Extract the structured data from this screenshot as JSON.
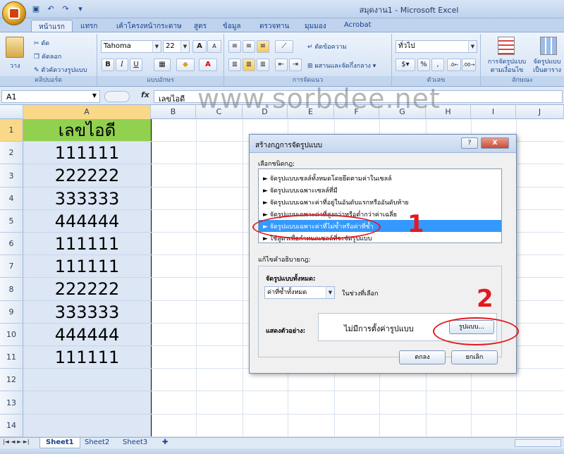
{
  "window": {
    "title": "สมุดงาน1 - Microsoft Excel"
  },
  "ribbon_tabs": [
    "หน้าแรก",
    "แทรก",
    "เค้าโครงหน้ากระดาษ",
    "สูตร",
    "ข้อมูล",
    "ตรวจทาน",
    "มุมมอง",
    "Acrobat"
  ],
  "clipboard": {
    "paste": "วาง",
    "cut": "ตัด",
    "copy": "คัดลอก",
    "format_painter": "ตัวคัดวางรูปแบบ",
    "label": "คลิปบอร์ด"
  },
  "font_group": {
    "font_name": "Tahoma",
    "font_size": "22",
    "bold": "B",
    "italic": "I",
    "underline": "U",
    "grow": "A",
    "shrink": "A",
    "label": "แบบอักษร"
  },
  "alignment_group": {
    "wrap_text": "ตัดข้อความ",
    "merge_center": "ผสานและจัดกึ่งกลาง",
    "label": "การจัดแนว"
  },
  "number_group": {
    "format": "ทั่วไป",
    "percent": "%",
    "comma": ",",
    "inc_decimal": "←.0 .00",
    "dec_decimal": ".00 →.0",
    "label": "ตัวเลข"
  },
  "styles_group": {
    "conditional": "การจัดรูปแบบ ตามเงื่อนไข",
    "as_table": "จัดรูปแบบ เป็นตาราง",
    "label": "ลักษณะ"
  },
  "formula_bar": {
    "name_box": "A1",
    "fx": "fx",
    "value": "เลขไอดี"
  },
  "watermark": "www.sorbdee.net",
  "columns": [
    "A",
    "B",
    "C",
    "D",
    "E",
    "F",
    "G",
    "H",
    "I",
    "J"
  ],
  "rows": [
    {
      "num": "1",
      "a": "เลขไอดี"
    },
    {
      "num": "2",
      "a": "111111"
    },
    {
      "num": "3",
      "a": "222222"
    },
    {
      "num": "4",
      "a": "333333"
    },
    {
      "num": "5",
      "a": "444444"
    },
    {
      "num": "6",
      "a": "111111"
    },
    {
      "num": "7",
      "a": "111111"
    },
    {
      "num": "8",
      "a": "222222"
    },
    {
      "num": "9",
      "a": "333333"
    },
    {
      "num": "10",
      "a": "444444"
    },
    {
      "num": "11",
      "a": "111111"
    },
    {
      "num": "12",
      "a": ""
    },
    {
      "num": "13",
      "a": ""
    },
    {
      "num": "14",
      "a": ""
    }
  ],
  "sheets": [
    "Sheet1",
    "Sheet2",
    "Sheet3"
  ],
  "dialog": {
    "title": "สร้างกฎการจัดรูปแบบ",
    "help": "?",
    "close": "X",
    "select_rule_type": "เลือกชนิดกฎ:",
    "rules": [
      "► จัดรูปแบบเซลล์ทั้งหมดโดยยึดตามค่าในเซลล์",
      "► จัดรูปแบบเฉพาะเซลล์ที่มี",
      "► จัดรูปแบบเฉพาะค่าที่อยู่ในอันดับแรกหรืออันดับท้าย",
      "► จัดรูปแบบเฉพาะค่าที่สูงกว่าหรือต่ำกว่าค่าเฉลี่ย",
      "► จัดรูปแบบเฉพาะค่าที่ไม่ซ้ำหรือค่าที่ซ้ำ",
      "► ใช้สูตรเพื่อกำหนดเซลล์ที่จะจัดรูปแบบ"
    ],
    "selected_rule_index": 4,
    "edit_rule_desc": "แก้ไขคำอธิบายกฎ:",
    "format_all": "จัดรูปแบบทั้งหมด:",
    "dup_select": "ค่าที่ซ้ำทั้งหมด",
    "in_range": "ในช่วงที่เลือก",
    "preview_label": "แสดงตัวอย่าง:",
    "preview_text": "ไม่มีการตั้งค่ารูปแบบ",
    "format_button": "รูปแบบ...",
    "ok": "ตกลง",
    "cancel": "ยกเลิก"
  },
  "annotations": {
    "mark1": "1",
    "mark2": "2",
    "color": "#e3191d"
  }
}
